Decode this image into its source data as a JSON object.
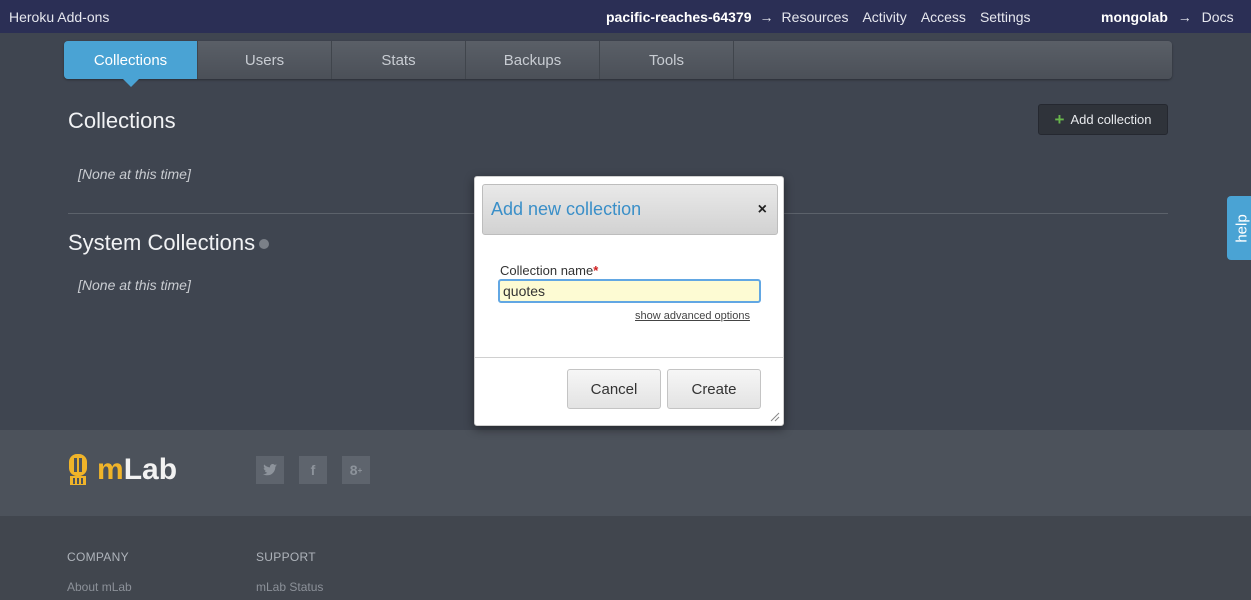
{
  "topbar": {
    "brand": "Heroku Add-ons",
    "app_name": "pacific-reaches-64379",
    "arrow": "→",
    "nav_items": [
      "Resources",
      "Activity",
      "Access",
      "Settings"
    ],
    "addon_name": "mongolab",
    "docs": "Docs"
  },
  "tabs": [
    "Collections",
    "Users",
    "Stats",
    "Backups",
    "Tools"
  ],
  "main": {
    "collections_title": "Collections",
    "collections_empty": "[None at this time]",
    "system_title": "System Collections",
    "system_empty": "[None at this time]",
    "add_button": "Add collection",
    "help_tab": "help"
  },
  "modal": {
    "title": "Add new collection",
    "close": "×",
    "field_label": "Collection name",
    "required_mark": "*",
    "field_value": "quotes",
    "advanced_link": "show advanced options",
    "cancel": "Cancel",
    "create": "Create"
  },
  "footer": {
    "logo_text_m": "m",
    "logo_text_rest": "Lab",
    "social": [
      "twitter-icon",
      "facebook-icon",
      "google-plus-icon"
    ],
    "columns": [
      {
        "heading": "COMPANY",
        "link": "About mLab"
      },
      {
        "heading": "SUPPORT",
        "link": "mLab Status"
      }
    ]
  },
  "colors": {
    "accent": "#4aa3d4",
    "topbar": "#2b2f55",
    "background": "#3f4550",
    "logo_yellow": "#f0b429"
  }
}
